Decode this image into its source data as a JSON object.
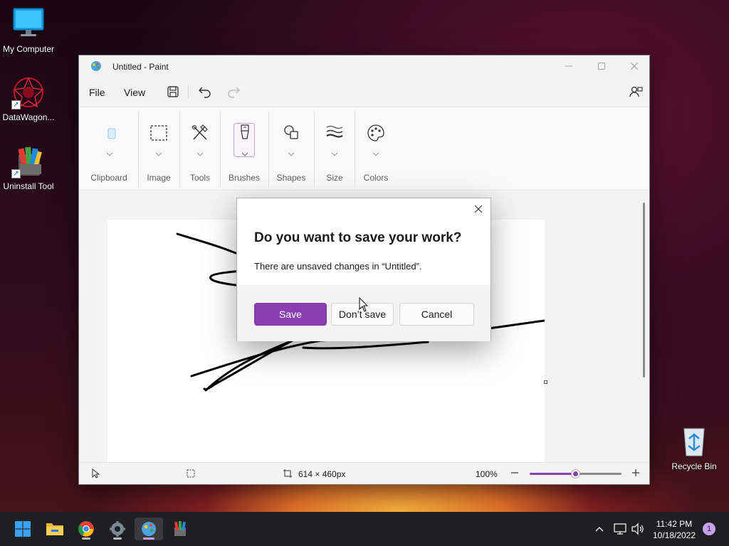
{
  "desktop": {
    "icons": [
      {
        "label": "My Computer",
        "icon": "monitor-icon"
      },
      {
        "label": "DataWagon...",
        "icon": "datawagon-icon"
      },
      {
        "label": "Uninstall Tool",
        "icon": "uninstall-tool-icon"
      },
      {
        "label": "Recycle Bin",
        "icon": "recycle-bin-icon"
      }
    ]
  },
  "window": {
    "title": "Untitled - Paint",
    "menu": {
      "file": "File",
      "view": "View"
    },
    "ribbon": {
      "groups": [
        "Clipboard",
        "Image",
        "Tools",
        "Brushes",
        "Shapes",
        "Size",
        "Colors"
      ]
    },
    "status": {
      "canvas_size": "614 × 460px",
      "zoom": "100%",
      "zoom_level": 0.5
    }
  },
  "dialog": {
    "title": "Do you want to save your work?",
    "message": "There are unsaved changes in “Untitled”.",
    "buttons": {
      "save": "Save",
      "dont_save": "Don’t save",
      "cancel": "Cancel"
    }
  },
  "taskbar": {
    "apps": [
      "start-icon",
      "file-explorer-icon",
      "chrome-icon",
      "settings-icon",
      "paint-icon",
      "uninstall-tool-icon"
    ],
    "active_app": "paint-icon",
    "clock": {
      "time": "11:42 PM",
      "date": "10/18/2022"
    },
    "notification_count": "1"
  },
  "colors": {
    "accent": "#8a3fb0",
    "taskbar": "#1f1f22"
  }
}
